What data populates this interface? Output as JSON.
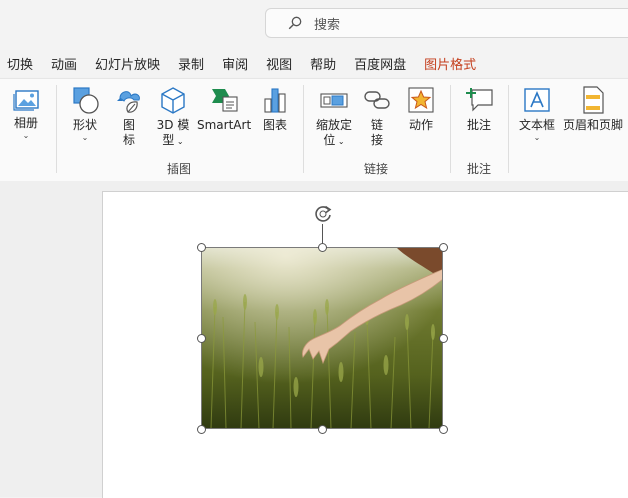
{
  "search": {
    "placeholder": "搜索"
  },
  "tabs": [
    {
      "label": "切换"
    },
    {
      "label": "动画"
    },
    {
      "label": "幻灯片放映"
    },
    {
      "label": "录制"
    },
    {
      "label": "审阅"
    },
    {
      "label": "视图"
    },
    {
      "label": "帮助"
    },
    {
      "label": "百度网盘"
    },
    {
      "label": "图片格式",
      "active": true
    }
  ],
  "ribbon": {
    "album": "相册",
    "shapes": "形状",
    "icons_l1": "图",
    "icons_l2": "标",
    "model3d_l1": "3D 模",
    "model3d_l2": "型",
    "smartart": "SmartArt",
    "chart": "图表",
    "zoom_l1": "缩放定",
    "zoom_l2": "位",
    "link_l1": "链",
    "link_l2": "接",
    "action": "动作",
    "comment": "批注",
    "textbox": "文本框",
    "header_footer": "页眉和页脚",
    "groups": {
      "illustrations": "插图",
      "links": "链接",
      "comments": "批注"
    }
  },
  "colors": {
    "accent": "#c43e1c",
    "icon_blue": "#2b78c5",
    "icon_green": "#1e8c4e"
  }
}
